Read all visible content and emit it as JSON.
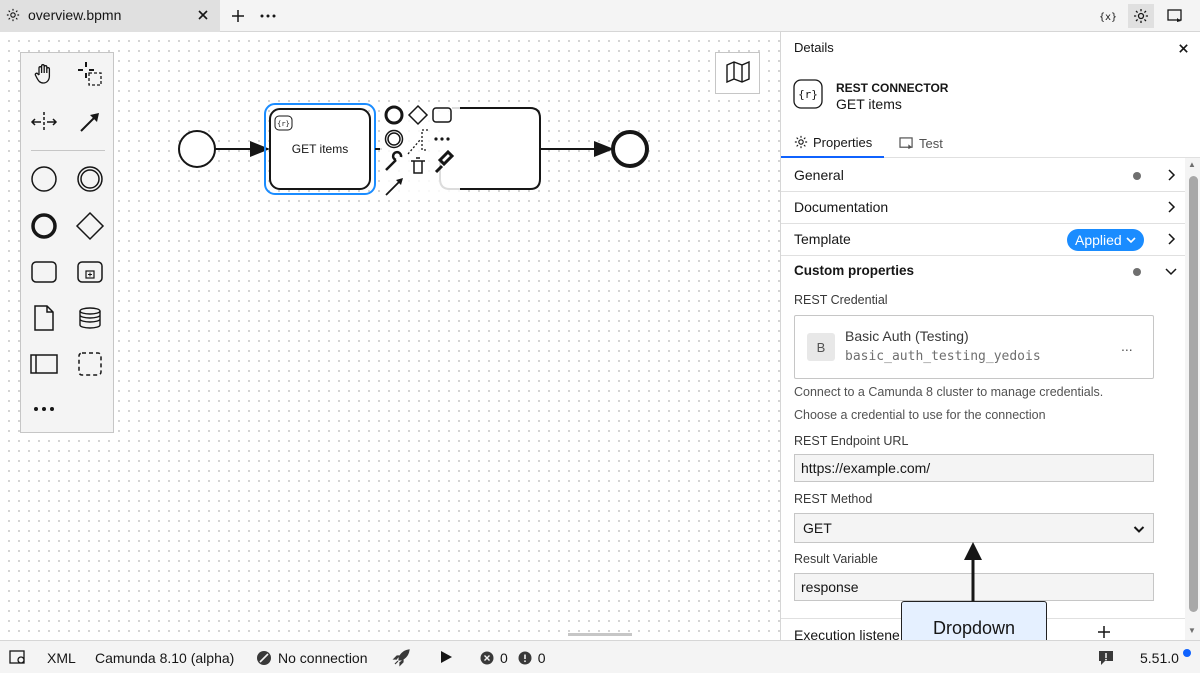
{
  "tab": {
    "title": "overview.bpmn"
  },
  "canvas": {
    "task_label": "GET items",
    "task_marker": "{r}"
  },
  "panel": {
    "title": "Details",
    "element_type": "REST CONNECTOR",
    "element_name": "GET items",
    "element_icon_text": "{r}",
    "tabs": [
      {
        "label": "Properties",
        "icon": "gear-icon",
        "active": true
      },
      {
        "label": "Test",
        "icon": "play-screen-icon",
        "active": false
      }
    ],
    "groups": {
      "general": "General",
      "documentation": "Documentation",
      "template": "Template",
      "template_badge": "Applied",
      "custom": "Custom properties"
    },
    "credential": {
      "label": "REST Credential",
      "avatar": "B",
      "name": "Basic Auth (Testing)",
      "id": "basic_auth_testing_yedois",
      "more": "...",
      "hint_1": "Connect to a Camunda 8 cluster to manage credentials.",
      "hint_2": "Choose a credential to use for the connection"
    },
    "endpoint": {
      "label": "REST Endpoint URL",
      "value": "https://example.com/"
    },
    "method": {
      "label": "REST Method",
      "value": "GET"
    },
    "result": {
      "label": "Result Variable",
      "value": "response"
    },
    "execution_listeners": "Execution listene"
  },
  "callout": {
    "text": "Dropdown"
  },
  "status": {
    "xml": "XML",
    "engine": "Camunda 8.10 (alpha)",
    "connection": "No connection",
    "errors": "0",
    "warnings": "0",
    "version": "5.51.0"
  },
  "colors": {
    "accent": "#0f62fe",
    "selection": "#1a8cff",
    "callout_bg": "#e5f0ff"
  }
}
